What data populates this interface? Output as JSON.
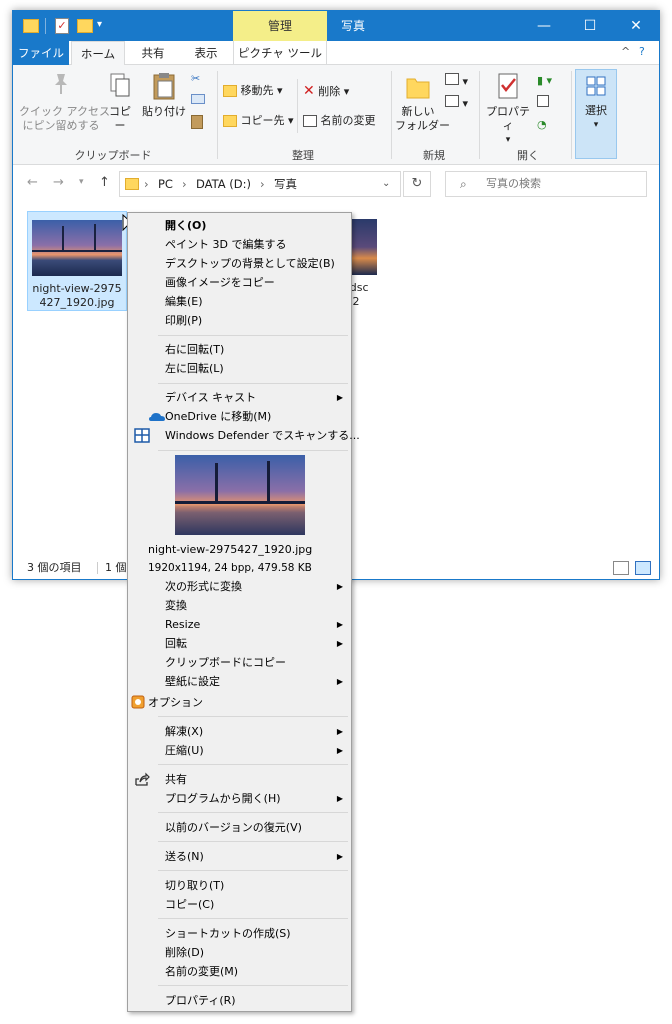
{
  "titlebar": {
    "context_tab": "管理",
    "title": "写真",
    "minimize": "—",
    "maximize": "☐",
    "close": "✕"
  },
  "tabs": {
    "file": "ファイル",
    "home": "ホーム",
    "share": "共有",
    "view": "表示",
    "picture_tools": "ピクチャ ツール"
  },
  "ribbon": {
    "quick_access": "クイック アクセス\nにピン留めする",
    "copy": "コピー",
    "paste": "貼り付け",
    "clipboard_group": "クリップボード",
    "move_to": "移動先",
    "copy_to": "コピー先",
    "delete": "削除",
    "rename": "名前の変更",
    "organize_group": "整理",
    "new_folder": "新しい\nフォルダー",
    "new_group": "新規",
    "properties": "プロパティ",
    "open_group": "開く",
    "select": "選択"
  },
  "address": {
    "crumbs": [
      "PC",
      "DATA (D:)",
      "写真"
    ],
    "search_placeholder": "写真の検索"
  },
  "files": [
    {
      "name": "night-view-2975427_1920.jpg",
      "line1": "night-view-2975",
      "line2": "427_1920.jpg"
    },
    {
      "name": "lands",
      "line1": "landsc",
      "line2": "_192"
    }
  ],
  "status": {
    "count": "3 個の項目",
    "selected": "1 個の"
  },
  "menu": {
    "open": "開く(O)",
    "paint3d": "ペイント 3D で編集する",
    "desktop_bg": "デスクトップの背景として設定(B)",
    "copy_image": "画像イメージをコピー",
    "edit": "編集(E)",
    "print": "印刷(P)",
    "rotate_right": "右に回転(T)",
    "rotate_left": "左に回転(L)",
    "device_cast": "デバイス キャスト",
    "onedrive": "OneDrive に移動(M)",
    "defender": "Windows Defender でスキャンする...",
    "preview_name": "night-view-2975427_1920.jpg",
    "preview_info": "1920x1194, 24 bpp, 479.58 KB",
    "convert_to": "次の形式に変換",
    "convert": "変換",
    "resize": "Resize",
    "rotate": "回転",
    "copy_clipboard": "クリップボードにコピー",
    "set_wallpaper": "壁紙に設定",
    "options": "オプション",
    "extract": "解凍(X)",
    "compress": "圧縮(U)",
    "share": "共有",
    "open_with": "プログラムから開く(H)",
    "restore_versions": "以前のバージョンの復元(V)",
    "send_to": "送る(N)",
    "cut": "切り取り(T)",
    "copy": "コピー(C)",
    "create_shortcut": "ショートカットの作成(S)",
    "delete": "削除(D)",
    "rename": "名前の変更(M)",
    "properties": "プロパティ(R)"
  },
  "colors": {
    "accent": "#1979ca",
    "context_tab": "#f4ee89",
    "selection": "#cce8ff"
  }
}
